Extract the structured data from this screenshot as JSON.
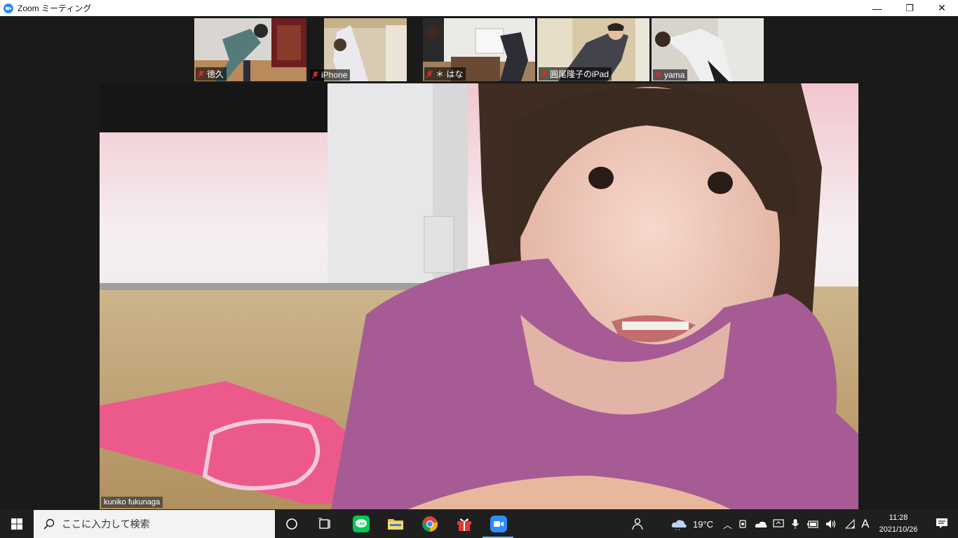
{
  "window": {
    "title": "Zoom ミーティング",
    "minimize": "—",
    "restore": "❐",
    "close": "✕"
  },
  "participants": [
    {
      "name": "徳久",
      "muted": true
    },
    {
      "name": "iPhone",
      "muted": true
    },
    {
      "name": "＊ はな",
      "muted": true
    },
    {
      "name": "圓尾隆子のiPad",
      "muted": true
    },
    {
      "name": "yama",
      "muted": true
    }
  ],
  "speaker": {
    "name": "kuniko fukunaga"
  },
  "taskbar": {
    "search_placeholder": "ここに入力して検索",
    "weather": "19°C",
    "ime": "A",
    "time": "11:28",
    "date": "2021/10/26"
  },
  "colors": {
    "zoom_blue": "#2d8cff",
    "mute_red": "#e02828",
    "taskbar": "#1f1f1f"
  }
}
